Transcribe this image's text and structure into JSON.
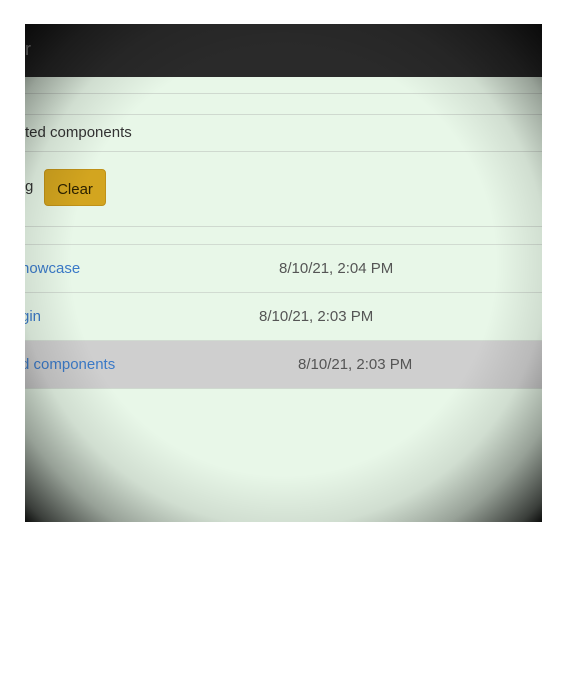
{
  "topbar": {
    "title": "r"
  },
  "page": {
    "subtitle": "ted components",
    "filter_tail": "g",
    "clear_label": "Clear"
  },
  "history": [
    {
      "label": "howcase",
      "timestamp": "8/10/21, 2:04 PM"
    },
    {
      "label": "gin",
      "timestamp": "8/10/21, 2:03 PM"
    },
    {
      "label": "d components",
      "timestamp": "8/10/21, 2:03 PM",
      "selected": true
    }
  ],
  "colors": {
    "background": "#e8f7e8",
    "topbar": "#2a2a2a",
    "button": "#d3a51f",
    "link": "#3b7ac8",
    "selected_row": "#cfcfcf"
  }
}
